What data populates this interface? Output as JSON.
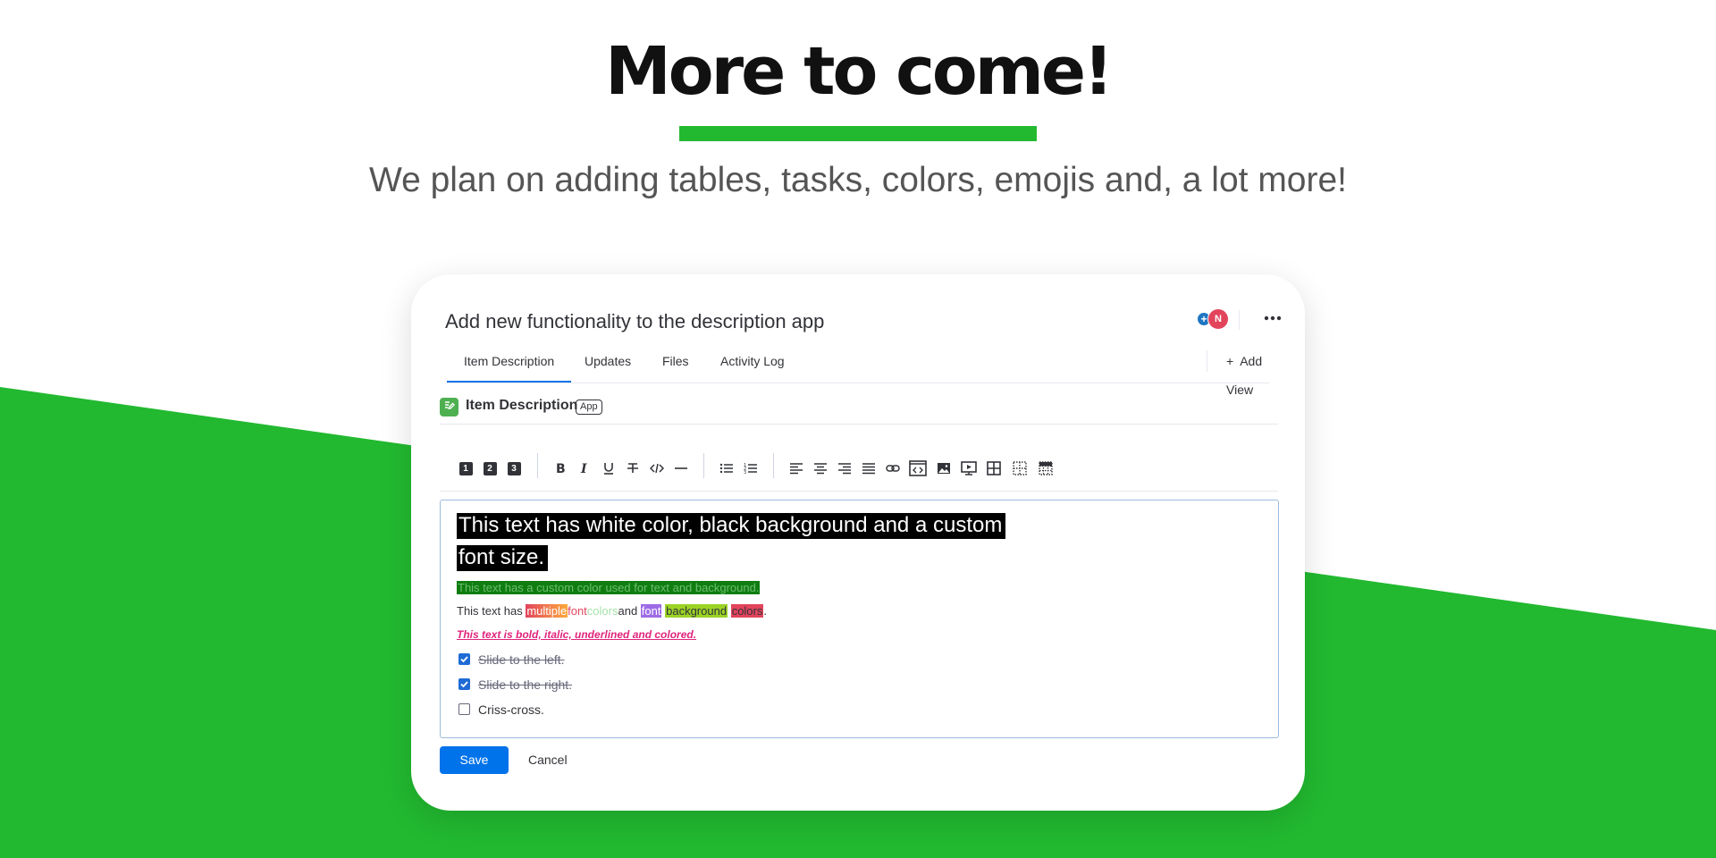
{
  "hero": {
    "title": "More to come!",
    "subtitle": "We plan on adding tables, tasks, colors, emojis and, a lot more!"
  },
  "colors": {
    "green": "#22b930",
    "primary": "#0073ea",
    "text": "#323338"
  },
  "item": {
    "title": "Add new functionality to the description app",
    "avatar_initial": "N",
    "avatar_plus": "+",
    "more_icon": "more-horizontal-icon"
  },
  "tabs": [
    {
      "label": "Item Description",
      "active": true
    },
    {
      "label": "Updates",
      "active": false
    },
    {
      "label": "Files",
      "active": false
    },
    {
      "label": "Activity Log",
      "active": false
    }
  ],
  "add_view": {
    "icon": "+",
    "label": "Add View"
  },
  "section": {
    "title": "Item Description",
    "badge": "App"
  },
  "toolbar": {
    "headings": [
      "1",
      "2",
      "3"
    ],
    "icons": [
      "bold-icon",
      "italic-icon",
      "underline-icon",
      "strikethrough-icon",
      "code-icon",
      "divider-icon",
      "bullet-list-icon",
      "numbered-list-icon",
      "align-left-icon",
      "align-center-icon",
      "align-right-icon",
      "align-justify-icon",
      "link-icon",
      "embed-icon",
      "image-icon",
      "video-icon",
      "table-icon",
      "table-borders-icon",
      "table-cells-icon"
    ]
  },
  "editor": {
    "line1a": "This text has white color, black background and a custom",
    "line1b": "font size.",
    "line2": "This text has a custom color used for text and background.",
    "line3": {
      "prefix": "This text has ",
      "w1": "multiple",
      "w2": "font",
      "w3": "colors",
      "mid": "and ",
      "w4": "font",
      "w5": "background",
      "w6": "colors",
      "end": "."
    },
    "line4": "This text is bold, italic, underlined and colored.",
    "checklist": [
      {
        "label": "Slide to the left.",
        "checked": true
      },
      {
        "label": "Slide to the right.",
        "checked": true
      },
      {
        "label": "Criss-cross.",
        "checked": false
      }
    ]
  },
  "actions": {
    "save": "Save",
    "cancel": "Cancel"
  }
}
